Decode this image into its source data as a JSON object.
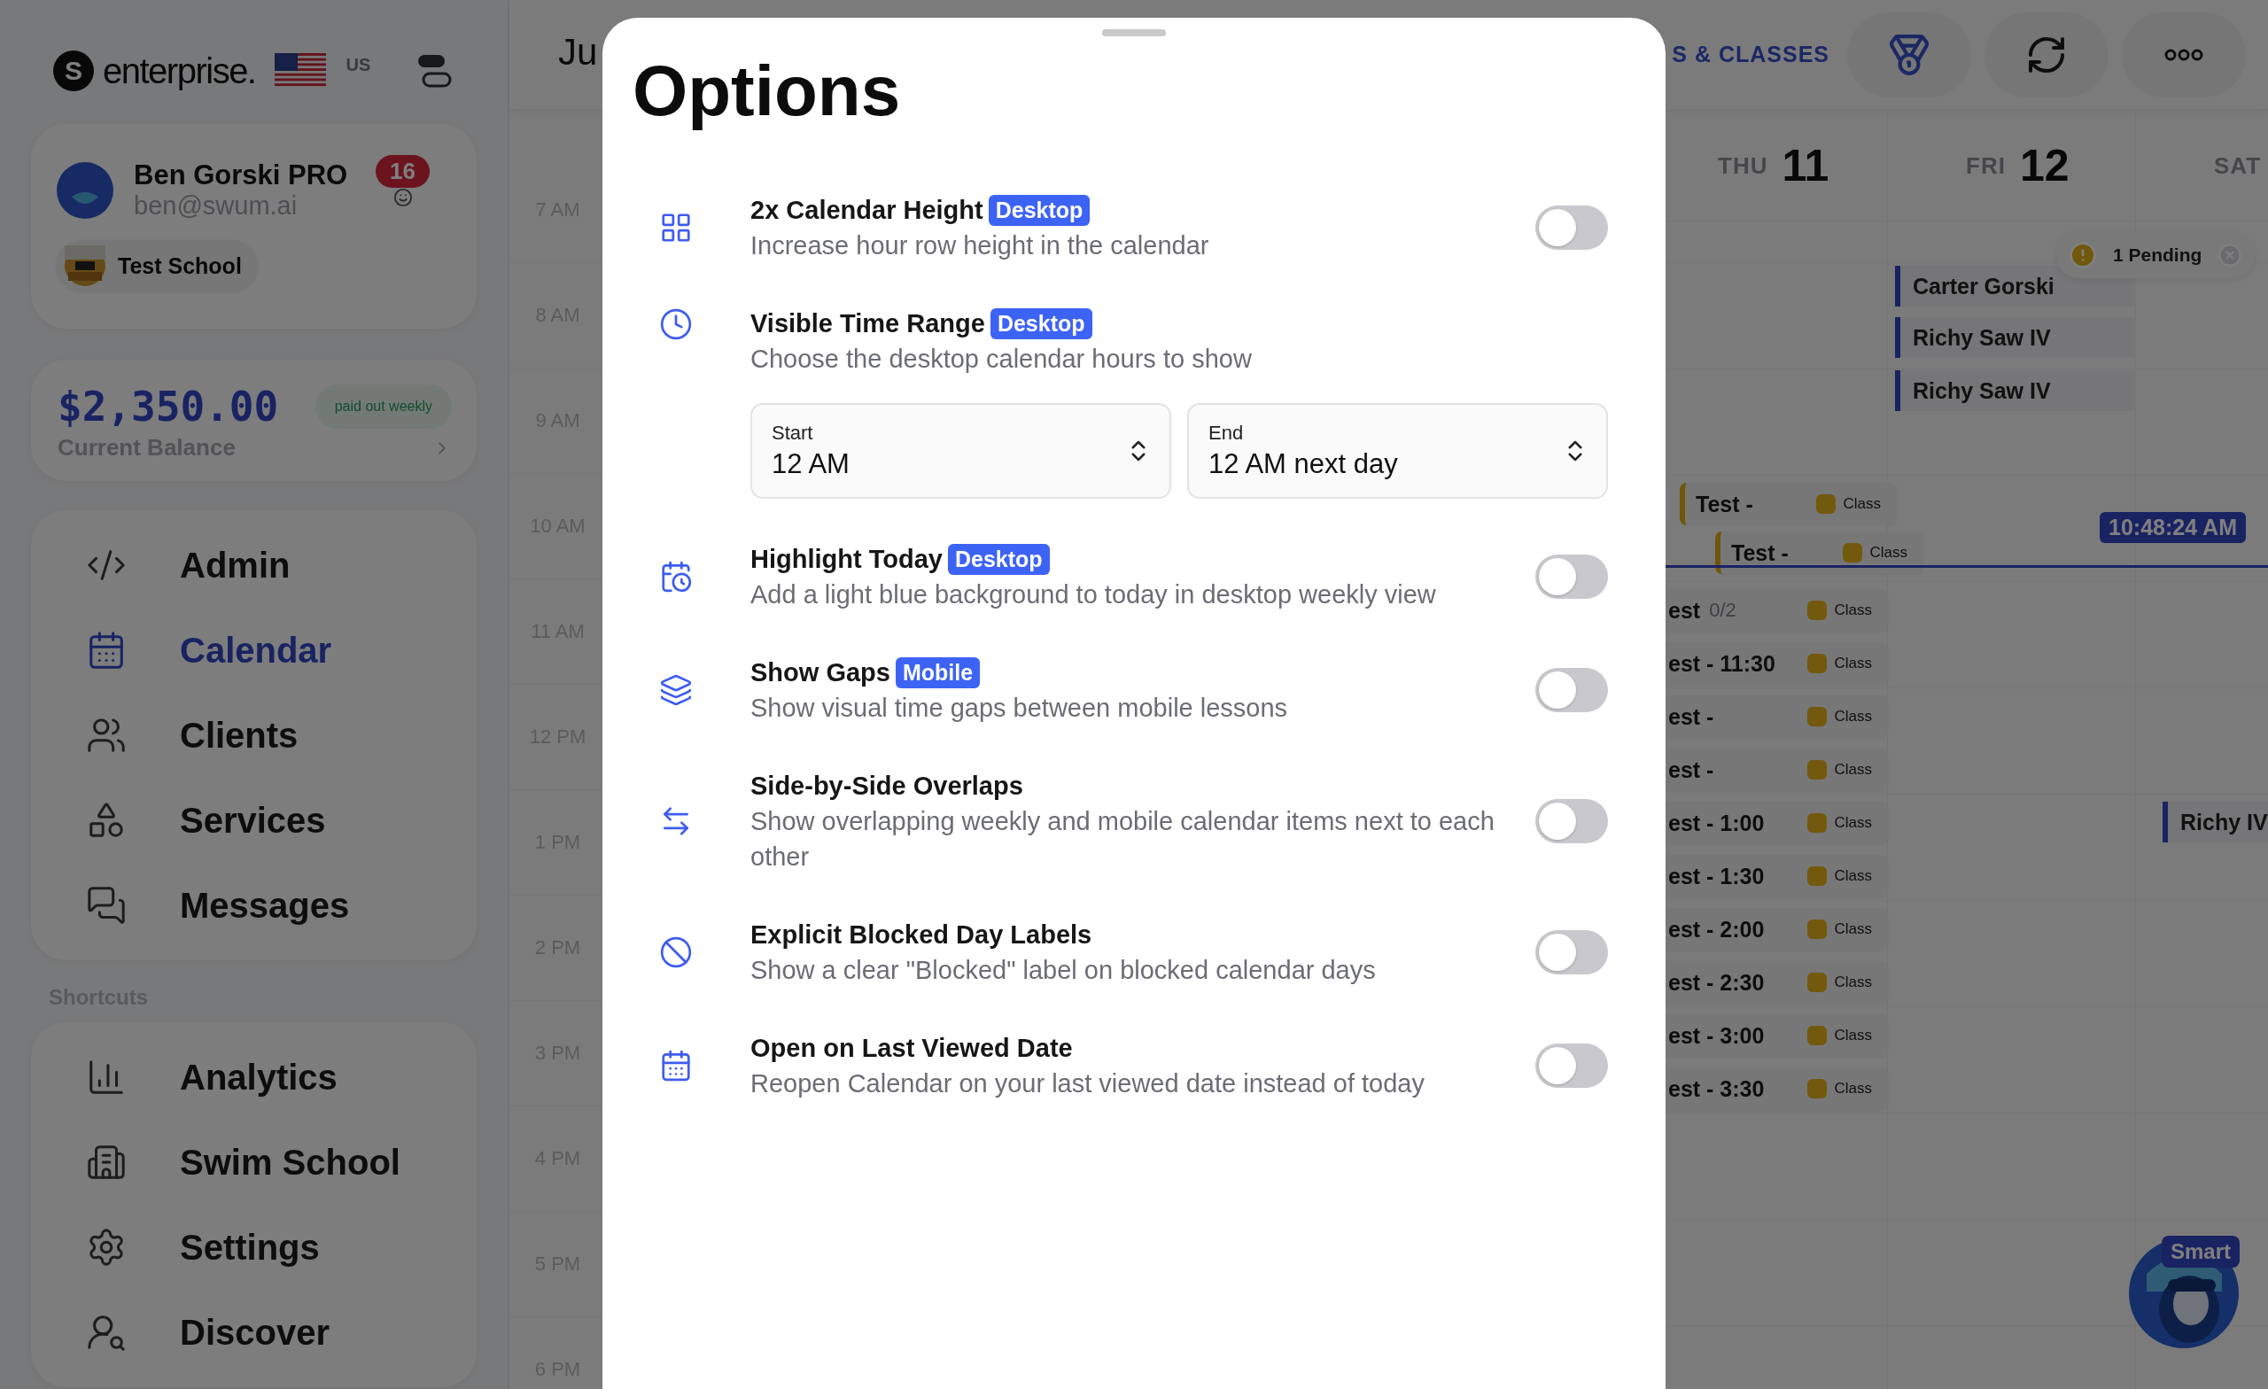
{
  "sidebar": {
    "logo_mark": "S",
    "brand": "enterprise.",
    "region": "US",
    "account": {
      "name": "Ben Gorski PRO",
      "email": "ben@swum.ai",
      "notifications": "16",
      "school": "Test School"
    },
    "balance": {
      "amount": "$2,350.00",
      "payout": "paid out weekly",
      "label": "Current Balance"
    },
    "nav": [
      {
        "label": "Admin",
        "selected": false
      },
      {
        "label": "Calendar",
        "selected": true
      },
      {
        "label": "Clients",
        "selected": false
      },
      {
        "label": "Services",
        "selected": false
      },
      {
        "label": "Messages",
        "selected": false
      }
    ],
    "shortcuts_heading": "Shortcuts",
    "shortcuts": [
      {
        "label": "Analytics",
        "selected": false
      },
      {
        "label": "Swim School",
        "selected": false
      },
      {
        "label": "Settings",
        "selected": false
      },
      {
        "label": "Discover",
        "selected": false
      }
    ]
  },
  "calendar": {
    "month_title": "Ju",
    "section_link": "S & CLASSES",
    "times": [
      "7 AM",
      "8 AM",
      "9 AM",
      "10 AM",
      "11 AM",
      "12 PM",
      "1 PM",
      "2 PM",
      "3 PM",
      "4 PM",
      "5 PM",
      "6 PM"
    ],
    "days": [
      {
        "weekday": "THU",
        "date": "11",
        "events": [
          {
            "kind": "class",
            "title": "Test -",
            "tag": "Class"
          },
          {
            "kind": "class",
            "title": "Test -",
            "tag": "Class"
          },
          {
            "kind": "class",
            "title": "est",
            "count": "0/2",
            "tag": "Class"
          },
          {
            "kind": "class",
            "title": "est - 11:30",
            "tag": "Class"
          },
          {
            "kind": "class",
            "title": "est -",
            "tag": "Class"
          },
          {
            "kind": "class",
            "title": "est -",
            "tag": "Class"
          },
          {
            "kind": "class",
            "title": "est - 1:00",
            "tag": "Class"
          },
          {
            "kind": "class",
            "title": "est - 1:30",
            "tag": "Class"
          },
          {
            "kind": "class",
            "title": "est - 2:00",
            "tag": "Class"
          },
          {
            "kind": "class",
            "title": "est - 2:30",
            "tag": "Class"
          },
          {
            "kind": "class",
            "title": "est - 3:00",
            "tag": "Class"
          },
          {
            "kind": "class",
            "title": "est - 3:30",
            "tag": "Class"
          }
        ]
      },
      {
        "weekday": "FRI",
        "date": "12",
        "pending": "1 Pending",
        "events": [
          {
            "kind": "lesson",
            "title": "Carter Gorski"
          },
          {
            "kind": "lesson",
            "title": "Richy Saw IV"
          },
          {
            "kind": "lesson",
            "title": "Richy Saw IV"
          }
        ]
      },
      {
        "weekday": "SAT",
        "events": [
          {
            "kind": "lesson",
            "title": "Richy IV"
          }
        ]
      }
    ],
    "now": "10:48:24 AM",
    "assistant_badge": "Smart"
  },
  "options": {
    "title": "Options",
    "rows": [
      {
        "kind": "toggle",
        "title": "2x Calendar Height",
        "badge": "Desktop",
        "description": "Increase hour row height in the calendar",
        "on": false
      },
      {
        "kind": "range",
        "title": "Visible Time Range",
        "badge": "Desktop",
        "description": "Choose the desktop calendar hours to show",
        "fields": [
          {
            "label": "Start",
            "value": "12 AM"
          },
          {
            "label": "End",
            "value": "12 AM next day"
          }
        ]
      },
      {
        "kind": "toggle",
        "title": "Highlight Today",
        "badge": "Desktop",
        "description": "Add a light blue background to today in desktop weekly view",
        "on": false
      },
      {
        "kind": "toggle",
        "title": "Show Gaps",
        "badge": "Mobile",
        "description": "Show visual time gaps between mobile lessons",
        "on": false
      },
      {
        "kind": "toggle",
        "title": "Side-by-Side Overlaps",
        "description": "Show overlapping weekly and mobile calendar items next to each other",
        "on": false
      },
      {
        "kind": "toggle",
        "title": "Explicit Blocked Day Labels",
        "description": "Show a clear \"Blocked\" label on blocked calendar days",
        "on": false
      },
      {
        "kind": "toggle",
        "title": "Open on Last Viewed Date",
        "description": "Reopen Calendar on your last viewed date instead of today",
        "on": false
      }
    ]
  }
}
